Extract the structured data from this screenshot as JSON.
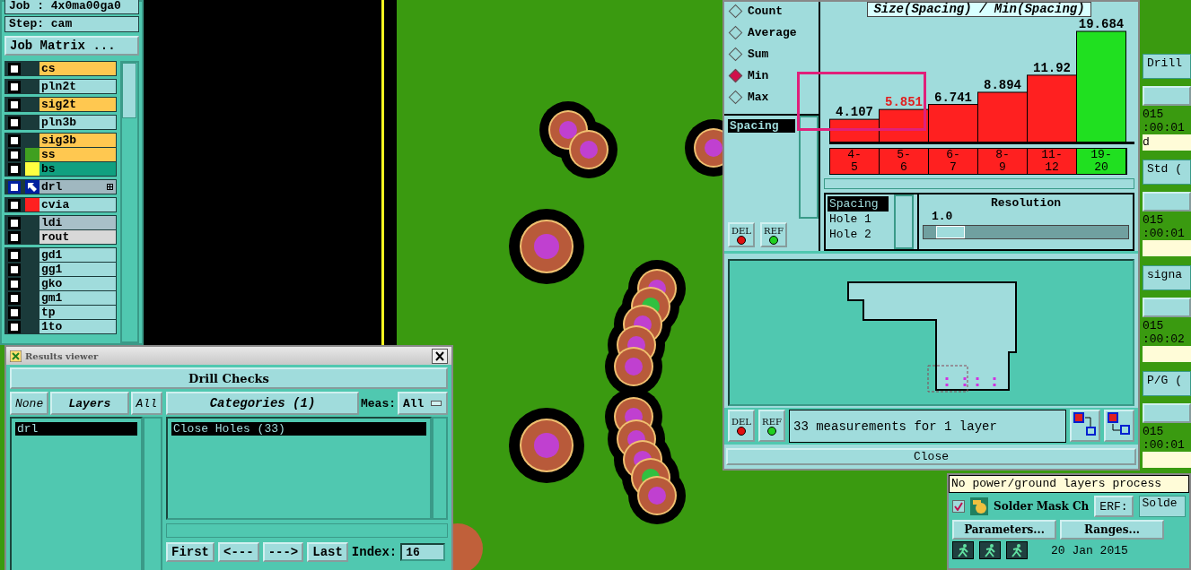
{
  "left_panel": {
    "job": "Job : 4x0ma00ga0",
    "step": "Step: cam",
    "matrix_button": "Job Matrix ...",
    "layer_groups": [
      {
        "layers": [
          {
            "name": "cs",
            "kind": "signal",
            "checked": false,
            "selected": false
          }
        ]
      },
      {
        "layers": [
          {
            "name": "pln2t",
            "kind": "plane",
            "checked": false,
            "selected": false
          }
        ]
      },
      {
        "layers": [
          {
            "name": "sig2t",
            "kind": "signal",
            "checked": false,
            "selected": false
          }
        ]
      },
      {
        "layers": [
          {
            "name": "pln3b",
            "kind": "plane",
            "checked": false,
            "selected": false
          }
        ]
      },
      {
        "layers": [
          {
            "name": "sig3b",
            "kind": "signal",
            "checked": false,
            "selected": false
          },
          {
            "name": "ss",
            "kind": "signal",
            "color": "#40a020",
            "checked": false,
            "selected": false
          },
          {
            "name": "bs",
            "kind": "mask",
            "color": "#ffff40",
            "checked": false,
            "selected": false
          }
        ]
      },
      {
        "layers": [
          {
            "name": "drl",
            "kind": "drill",
            "checked": false,
            "selected": true
          }
        ]
      },
      {
        "layers": [
          {
            "name": "cvia",
            "kind": "plane",
            "color": "#ff2020",
            "checked": false,
            "selected": false
          }
        ]
      },
      {
        "layers": [
          {
            "name": "ldi",
            "kind": "document",
            "checked": false,
            "selected": false
          },
          {
            "name": "rout",
            "kind": "rout",
            "checked": false,
            "selected": false
          }
        ]
      },
      {
        "layers": [
          {
            "name": "gd1",
            "kind": "plane",
            "checked": false,
            "selected": false
          },
          {
            "name": "gg1",
            "kind": "plane",
            "checked": false,
            "selected": false
          },
          {
            "name": "gko",
            "kind": "plane",
            "checked": false,
            "selected": false
          },
          {
            "name": "gm1",
            "kind": "plane",
            "checked": false,
            "selected": false
          },
          {
            "name": "tp",
            "kind": "plane",
            "checked": false,
            "selected": false
          },
          {
            "name": "1to",
            "kind": "plane",
            "checked": false,
            "selected": false
          }
        ]
      }
    ]
  },
  "results_viewer": {
    "title": "Results viewer",
    "header": "Drill Checks",
    "layer_buttons": [
      {
        "label": "None",
        "kind": "toggle"
      },
      {
        "label": "Layers",
        "kind": "title"
      },
      {
        "label": "All",
        "kind": "toggle"
      }
    ],
    "layers": [
      {
        "name": "drl",
        "selected": true
      }
    ],
    "categories_button": "Categories (1)",
    "meas_label": "Meas:",
    "meas_value": "All",
    "categories": [
      {
        "name": "Close Holes (33)",
        "selected": true
      }
    ],
    "nav_buttons": [
      "First",
      "<---",
      "--->",
      "Last"
    ],
    "index_label": "Index:",
    "index_value": "16"
  },
  "histogram_window": {
    "measure_options": [
      {
        "label": "Count",
        "selected": false
      },
      {
        "label": "Average",
        "selected": false
      },
      {
        "label": "Sum",
        "selected": false
      },
      {
        "label": "Min",
        "selected": true
      },
      {
        "label": "Max",
        "selected": false
      }
    ],
    "measures": [
      {
        "name": "Spacing",
        "selected": true
      }
    ],
    "side_buttons": [
      "DEL",
      "REF"
    ],
    "chart": {
      "chart_data": {
        "type": "bar",
        "title": "Size(Spacing) / Min(Spacing)",
        "categories": [
          "4-5",
          "5-6",
          "6-7",
          "8-9",
          "11-12",
          "19-20"
        ],
        "values": [
          4.107,
          5.851,
          6.741,
          8.894,
          11.92,
          19.684
        ],
        "data_labels": true
      },
      "bar_styles": [
        {
          "color": "#ff2020",
          "selected": false
        },
        {
          "color": "#ff2020",
          "selected": true
        },
        {
          "color": "#ff2020",
          "selected": false
        },
        {
          "color": "#ff2020",
          "selected": false
        },
        {
          "color": "#ff2020",
          "selected": false
        },
        {
          "color": "#20e020",
          "selected": false
        }
      ]
    },
    "attributes": [
      {
        "name": "Spacing",
        "selected": true
      },
      {
        "name": "Hole 1",
        "selected": false
      },
      {
        "name": "Hole 2",
        "selected": false
      }
    ],
    "resolution": {
      "label": "Resolution",
      "value": "1.0",
      "level": 0.06
    },
    "status_buttons": [
      "DEL",
      "REF"
    ],
    "status": "33 measurements for 1 layer",
    "close_button": "Close"
  },
  "right_column": [
    {
      "field": "Drill",
      "date": "015",
      "time": ":00:01",
      "note": "d"
    },
    {
      "field": "Std (",
      "date": "015",
      "time": ":00:01"
    },
    {
      "field": "signa",
      "date": "015",
      "time": ":00:02"
    },
    {
      "field": "P/G (",
      "date": "015",
      "time": ":00:01"
    }
  ],
  "check_panel": {
    "message": "No power/ground layers process",
    "checked": true,
    "name": "Solder Mask Ch",
    "erf_button": "ERF:",
    "erf_value": "Solde",
    "buttons": [
      "Parameters...",
      "Ranges..."
    ],
    "date": "20 Jan 2015"
  }
}
